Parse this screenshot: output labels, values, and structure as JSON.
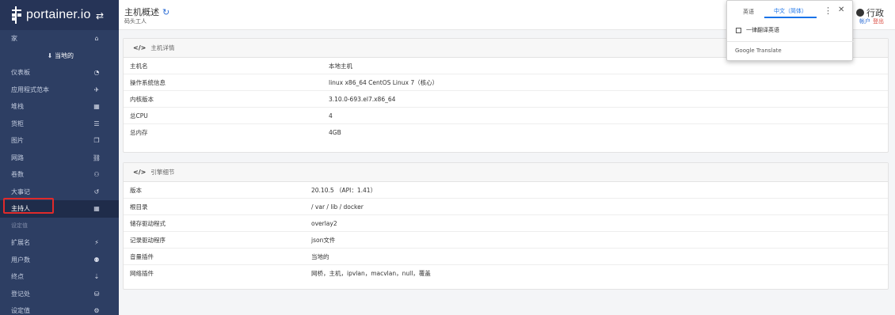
{
  "sidebar": {
    "brand": "portainer.io",
    "toggle_icon": "⇄",
    "items": [
      {
        "label": "家",
        "icon": "⌂",
        "type": "item"
      },
      {
        "label": "当地的",
        "icon": "⬇",
        "type": "sub"
      },
      {
        "label": "仪表板",
        "icon": "◔",
        "type": "item"
      },
      {
        "label": "应用程式范本",
        "icon": "✈",
        "type": "item"
      },
      {
        "label": "堆栈",
        "icon": "▦",
        "type": "item"
      },
      {
        "label": "货柜",
        "icon": "☰",
        "type": "item"
      },
      {
        "label": "图片",
        "icon": "❐",
        "type": "item"
      },
      {
        "label": "网路",
        "icon": "⛓",
        "type": "item"
      },
      {
        "label": "卷数",
        "icon": "⚇",
        "type": "item"
      },
      {
        "label": "大事记",
        "icon": "↺",
        "type": "item"
      },
      {
        "label": "主持人",
        "icon": "▦",
        "type": "item",
        "active": true
      }
    ],
    "section_label": "设定值",
    "settings_items": [
      {
        "label": "扩展名",
        "icon": "⚡"
      },
      {
        "label": "用户数",
        "icon": "⚉"
      },
      {
        "label": "终点",
        "icon": "⇣"
      },
      {
        "label": "登记处",
        "icon": "⛁"
      },
      {
        "label": "设定值",
        "icon": "⚙"
      }
    ]
  },
  "header": {
    "title": "主机概述",
    "refresh_icon": "↻",
    "subtitle": "码头工人",
    "user_name": "行政",
    "links": [
      "帐户",
      "登出"
    ]
  },
  "host_panel": {
    "heading": "主机详情",
    "rows": [
      {
        "key": "主机名",
        "value": "本地主机"
      },
      {
        "key": "操作系统信息",
        "value": "linux x86_64 CentOS Linux 7（核心）"
      },
      {
        "key": "内核版本",
        "value": "3.10.0-693.el7.x86_64"
      },
      {
        "key": "总CPU",
        "value": "4"
      },
      {
        "key": "总内存",
        "value": "4GB"
      }
    ]
  },
  "engine_panel": {
    "heading": "引擎细节",
    "rows": [
      {
        "key": "版本",
        "value": "20.10.5 （API：1.41）"
      },
      {
        "key": "根目录",
        "value": "/ var / lib / docker"
      },
      {
        "key": "储存驱动程式",
        "value": "overlay2"
      },
      {
        "key": "记录驱动程序",
        "value": "json文件"
      },
      {
        "key": "音量插件",
        "value": "当地的"
      },
      {
        "key": "网络插件",
        "value": "网桥，主机，ipvlan，macvlan，null，覆盖"
      }
    ]
  },
  "translate_popup": {
    "tab_source": "英语",
    "tab_target": "中文（简体）",
    "more_icon": "⋮",
    "close_icon": "✕",
    "checkbox_label": "一律翻译英语",
    "brand": "Google Translate"
  },
  "colors": {
    "sidebar_bg": "#2d3e63",
    "active_bg": "#1f2c4a",
    "highlight": "#e02a2a",
    "accent_blue": "#1a73e8"
  }
}
